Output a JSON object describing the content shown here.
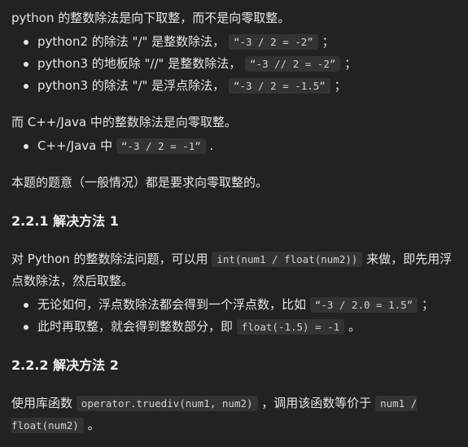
{
  "intro": {
    "text": "python 的整数除法是向下取整，而不是向零取整。"
  },
  "python_items": [
    {
      "label": "python2 的除法 \"/\" 是整数除法，",
      "code": "“-3 / 2 = -2”",
      "tail": "；"
    },
    {
      "label": "python3 的地板除 \"//\" 是整数除法，",
      "code": "“-3 // 2 = -2”",
      "tail": "；"
    },
    {
      "label": "python3 的除法 \"/\" 是浮点除法，",
      "code": "“-3 / 2 = -1.5”",
      "tail": "；"
    }
  ],
  "cpp_intro": {
    "text": "而 C++/Java 中的整数除法是向零取整。"
  },
  "cpp_items": [
    {
      "label": "C++/Java 中",
      "code": "“-3 / 2 = -1”",
      "tail": "."
    }
  ],
  "summary": {
    "text": "本题的题意（一般情况）都是要求向零取整的。"
  },
  "section1": {
    "heading": "2.2.1 解决方法 1",
    "para_pre": "对 Python 的整数除法问题，可以用",
    "para_code": "int(num1 / float(num2))",
    "para_post": "来做，即先用浮点数除法，然后取整。",
    "items": [
      {
        "label": "无论如何，浮点数除法都会得到一个浮点数，比如",
        "code": "“-3 / 2.0 = 1.5”",
        "tail": "；"
      },
      {
        "label": "此时再取整，就会得到整数部分，即",
        "code": "float(-1.5) = -1",
        "tail": "。"
      }
    ]
  },
  "section2": {
    "heading": "2.2.2 解决方法 2",
    "para_pre": "使用库函数",
    "para_code": "operator.truediv(num1, num2)",
    "para_mid": "，调用该函数等价于",
    "para_code2": "num1 / float(num2)",
    "para_post": "。"
  }
}
